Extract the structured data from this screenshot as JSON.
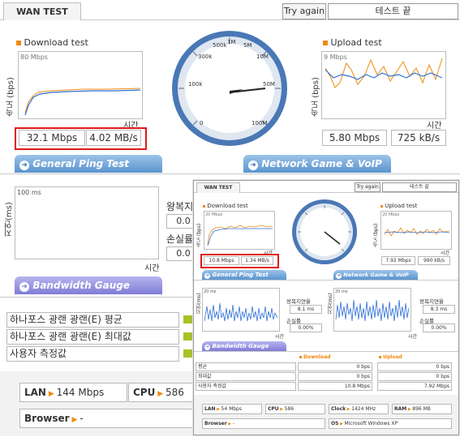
{
  "back": {
    "tab": "WAN TEST",
    "try_again": "Try again",
    "test_end": "테스트 끝",
    "download": {
      "title": "Download test",
      "scale": "80 Mbps",
      "ylabel": "속도 (bps)",
      "xlabel": "시간",
      "mbps": "32.1 Mbps",
      "mbs": "4.02 MB/s"
    },
    "upload": {
      "title": "Upload test",
      "scale": "9 Mbps",
      "ylabel": "속도 (bps)",
      "xlabel": "시간",
      "mbps": "5.80 Mbps",
      "kbs": "725 kB/s"
    },
    "gauge": {
      "ticks": [
        "0",
        "100k",
        "300k",
        "500k",
        "1M",
        "5M",
        "10M",
        "50M",
        "100M"
      ]
    },
    "ping_header": "General Ping Test",
    "voip_header": "Network Game & VoIP Test",
    "ping": {
      "scale": "100 ms",
      "ylabel": "지연(ms)",
      "xlabel": "시간",
      "rtt_label": "왕복지",
      "rtt_value": "0.0",
      "loss_label": "손실률",
      "loss_value": "0.0"
    },
    "bandwidth_header": "Bandwidth Gauge",
    "rows": [
      "하나포스 광랜 광랜(E) 평균",
      "하나포스 광랜 광랜(E) 최대값",
      "사용자 측정값"
    ],
    "lan_label": "LAN",
    "lan_value": "144 Mbps",
    "cpu_label": "CPU",
    "cpu_value": "586",
    "browser_label": "Browser",
    "browser_value": "-"
  },
  "front": {
    "tab": "WAN TEST",
    "try_again": "Try again",
    "test_end": "테스트 끝",
    "download": {
      "title": "Download test",
      "scale": "20 Mbps",
      "ylabel": "속도 (bps)",
      "xlabel": "시간",
      "mbps": "10.8 Mbps",
      "mbs": "1.34 MB/s"
    },
    "upload": {
      "title": "Upload test",
      "scale": "20 Mbps",
      "ylabel": "속도 (bps)",
      "xlabel": "시간",
      "mbps": "7.92 Mbps",
      "kbs": "990 kB/s"
    },
    "ping_header": "General Ping Test",
    "voip_header": "Network Game & VoIP Test",
    "ping_left": {
      "scale": "20 ms",
      "ylabel": "지연(ms)",
      "xlabel": "시간",
      "rtt_label": "왕복지연율",
      "rtt_value": "8.1 ms",
      "loss_label": "손실률",
      "loss_value": "0.00%"
    },
    "ping_right": {
      "scale": "20 ms",
      "ylabel": "지연(ms)",
      "xlabel": "시간",
      "rtt_label": "왕복지연율",
      "rtt_value": "8.3 ms",
      "loss_label": "손실률",
      "loss_value": "0.00%"
    },
    "bandwidth_header": "Bandwidth Gauge",
    "table": {
      "download_header": "Download",
      "upload_header": "Upload",
      "rows": [
        {
          "label": "평균",
          "down": "0 bps",
          "up": "0 bps"
        },
        {
          "label": "최대값",
          "down": "0 bps",
          "up": "0 bps"
        },
        {
          "label": "사용자 측정값",
          "down": "10.8 Mbps",
          "up": "7.92 Mbps"
        }
      ]
    },
    "sys": {
      "lan_label": "LAN",
      "lan_value": "54 Mbps",
      "cpu_label": "CPU",
      "cpu_value": "586",
      "clock_label": "Clock",
      "clock_value": "1424 MHz",
      "ram_label": "RAM",
      "ram_value": "896 MB",
      "browser_label": "Browser",
      "browser_value": "-",
      "os_label": "OS",
      "os_value": "Microsoft Windows XP"
    }
  },
  "colors": {
    "accent_blue": "#5b94cf",
    "highlight_red": "#e01818",
    "orange": "#f08a10",
    "line_blue": "#2f6fd6",
    "gauge_blue": "#4a78b5"
  }
}
